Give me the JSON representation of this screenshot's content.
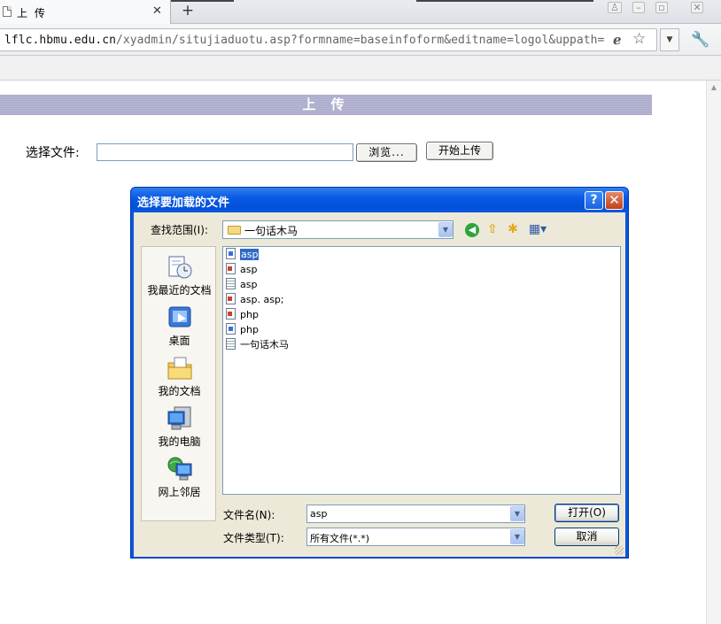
{
  "browser": {
    "tab_title": "上 传",
    "tab_close": "✕",
    "new_tab": "+",
    "url_host": "lflc.hbmu.edu.cn",
    "url_path": "/xyadmin/situjiaduotu.asp?formname=baseinfoform&editname=logol&uppath="
  },
  "page": {
    "header": "上 传",
    "choose_label": "选择文件:",
    "browse_button": "浏览...",
    "start_button": "开始上传"
  },
  "dialog": {
    "title": "选择要加载的文件",
    "help": "?",
    "close": "✕",
    "lookin_label": "查找范围(I):",
    "lookin_value": "一句话木马",
    "places": [
      {
        "label": "我最近的文档",
        "icon": "recent-documents-icon"
      },
      {
        "label": "桌面",
        "icon": "desktop-icon"
      },
      {
        "label": "我的文档",
        "icon": "my-documents-icon"
      },
      {
        "label": "我的电脑",
        "icon": "my-computer-icon"
      },
      {
        "label": "网上邻居",
        "icon": "network-places-icon"
      }
    ],
    "files": [
      {
        "name": "asp",
        "icon": "blue",
        "selected": true
      },
      {
        "name": "asp",
        "icon": "red"
      },
      {
        "name": "asp",
        "icon": "lines"
      },
      {
        "name": "asp. asp;",
        "icon": "red"
      },
      {
        "name": "php",
        "icon": "red"
      },
      {
        "name": "php",
        "icon": "blue"
      },
      {
        "name": "一句话木马",
        "icon": "lines"
      }
    ],
    "filename_label": "文件名(N):",
    "filename_value": "asp",
    "filetype_label": "文件类型(T):",
    "filetype_value": "所有文件(*.*)",
    "open_button": "打开(O)",
    "cancel_button": "取消"
  }
}
